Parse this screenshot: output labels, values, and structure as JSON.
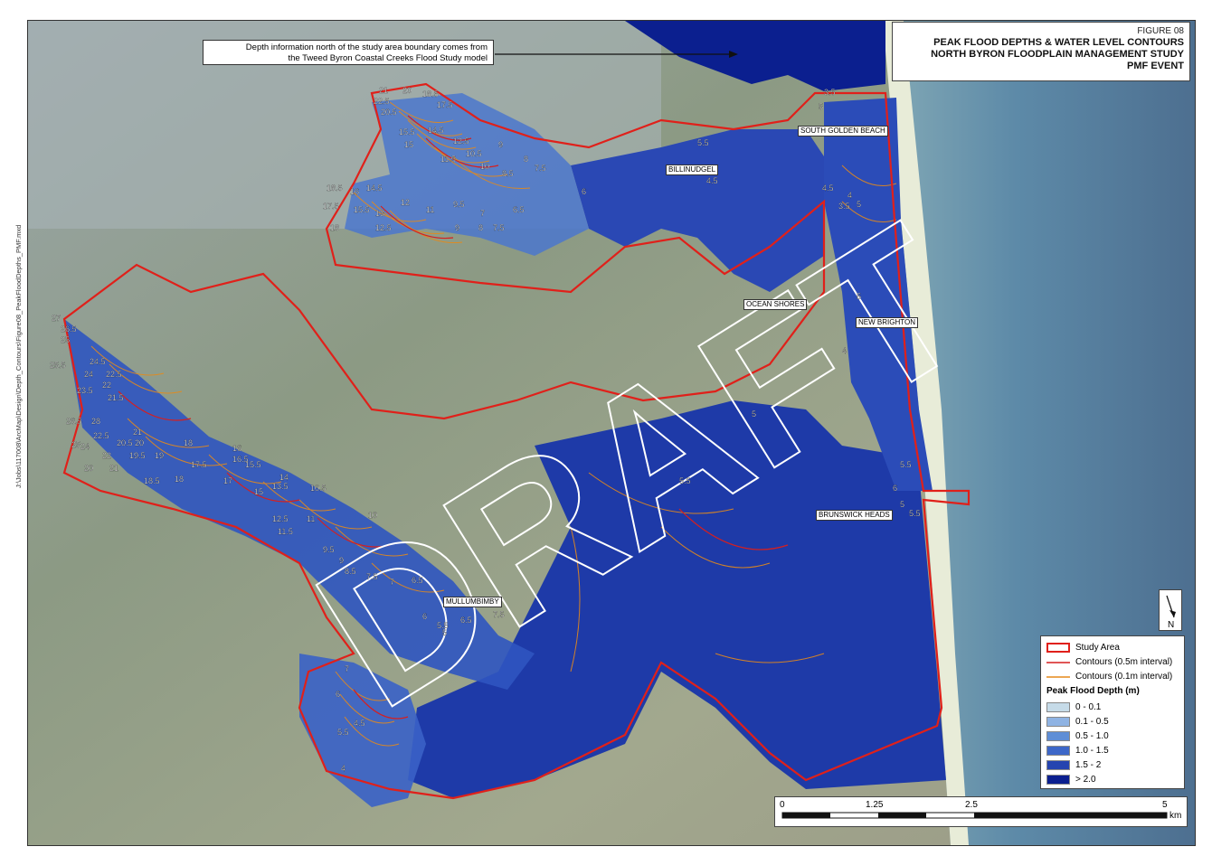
{
  "title": {
    "figure": "FIGURE 08",
    "lines": [
      "PEAK FLOOD DEPTHS & WATER LEVEL CONTOURS",
      "NORTH BYRON FLOODPLAIN MANAGEMENT STUDY",
      "PMF EVENT"
    ]
  },
  "note": {
    "line1": "Depth information north of the study area boundary comes from",
    "line2": "the Tweed Byron Coastal Creeks Flood Study model"
  },
  "watermark": "DRAFT",
  "file_path": "J:\\Jobs\\117008\\ArcMap\\Design\\Depth_Contours\\Figure08_PeakFloodDepths_PMF.mxd",
  "places": [
    "SOUTH GOLDEN BEACH",
    "BILLINUDGEL",
    "OCEAN SHORES",
    "NEW BRIGHTON",
    "BRUNSWICK HEADS",
    "MULLUMBIMBY"
  ],
  "legend": {
    "study_area": "Study Area",
    "contour_05": "Contours (0.5m interval)",
    "contour_01": "Contours (0.1m interval)",
    "depth_heading": "Peak Flood Depth (m)",
    "classes": [
      {
        "label": "0 - 0.1",
        "color": "#c6dbe8"
      },
      {
        "label": "0.1 - 0.5",
        "color": "#8fb3e3"
      },
      {
        "label": "0.5 - 1.0",
        "color": "#5f8ed6"
      },
      {
        "label": "1.0 - 1.5",
        "color": "#3d67c8"
      },
      {
        "label": "1.5 - 2",
        "color": "#2544b0"
      },
      {
        "label": "> 2.0",
        "color": "#0b1f8f"
      }
    ]
  },
  "scale": {
    "ticks": [
      "0",
      "1.25",
      "2.5",
      "5"
    ],
    "unit": "km"
  },
  "north": "N",
  "contour_labels": [
    "21",
    "20",
    "18.5",
    "22.5",
    "17.5",
    "20.5",
    "15.5",
    "14.5",
    "15",
    "12.5",
    "11.5",
    "10.5",
    "9",
    "8",
    "7.5",
    "10",
    "8.5",
    "6",
    "18.5",
    "17.5",
    "16",
    "14.5",
    "15.5",
    "13",
    "12",
    "11",
    "9.5",
    "7",
    "6.5",
    "18",
    "12.5",
    "9",
    "8",
    "7.5",
    "27",
    "26.5",
    "25",
    "25.5",
    "24.5",
    "24",
    "22.5",
    "23.5",
    "22",
    "21.5",
    "26.5",
    "28",
    "25",
    "22.5",
    "21",
    "20.5",
    "20",
    "19.5",
    "24",
    "22",
    "20",
    "21",
    "19",
    "18",
    "17.5",
    "16",
    "15.5",
    "16.5",
    "18.5",
    "18",
    "17",
    "15",
    "14",
    "13.5",
    "12.5",
    "11.5",
    "11",
    "10.5",
    "10",
    "9.5",
    "9",
    "8.5",
    "7.5",
    "7",
    "6.5",
    "6",
    "5.5",
    "5",
    "6.5",
    "7.5",
    "7",
    "6",
    "5.5",
    "4.5",
    "4",
    "3.5",
    "5",
    "4.5",
    "4",
    "3.5",
    "5",
    "5.5",
    "4.5",
    "5",
    "4",
    "5",
    "5.5",
    "6",
    "5",
    "5.5",
    "5.5"
  ]
}
